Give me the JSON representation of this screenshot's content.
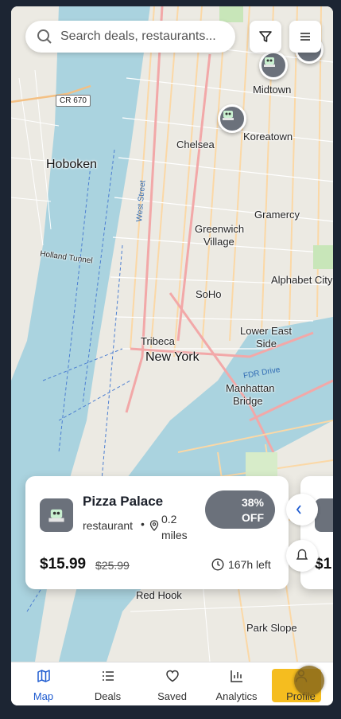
{
  "search": {
    "placeholder": "Search deals, restaurants..."
  },
  "map": {
    "labels": [
      {
        "name": "Hoboken",
        "kind": "big"
      },
      {
        "name": "Chelsea",
        "kind": "normal"
      },
      {
        "name": "Midtown",
        "kind": "normal"
      },
      {
        "name": "Koreatown",
        "kind": "normal"
      },
      {
        "name": "Gramercy",
        "kind": "normal"
      },
      {
        "name": "Greenwich",
        "kind": "normal"
      },
      {
        "name": "Village",
        "kind": "normal"
      },
      {
        "name": "Alphabet City",
        "kind": "normal"
      },
      {
        "name": "SoHo",
        "kind": "normal"
      },
      {
        "name": "Lower East",
        "kind": "normal"
      },
      {
        "name": "Side",
        "kind": "normal"
      },
      {
        "name": "Tribeca",
        "kind": "normal"
      },
      {
        "name": "New York",
        "kind": "big"
      },
      {
        "name": "Manhattan",
        "kind": "normal"
      },
      {
        "name": "Bridge",
        "kind": "normal"
      },
      {
        "name": "Red Hook",
        "kind": "normal"
      },
      {
        "name": "Park Slope",
        "kind": "normal"
      },
      {
        "name": "Holland Tunnel",
        "kind": "normal"
      },
      {
        "name": "CR 670",
        "kind": "shield"
      },
      {
        "name": "West Street",
        "kind": "road"
      },
      {
        "name": "FDR Drive",
        "kind": "road"
      }
    ]
  },
  "deal": {
    "name": "Pizza Palace",
    "type": "restaurant",
    "separator": "•",
    "distance": "0.2 miles",
    "discount_line1": "38%",
    "discount_line2": "OFF",
    "price": "$15.99",
    "old_price": "$25.99",
    "time_left": "167h left"
  },
  "next_deal": {
    "price_prefix": "$1"
  },
  "tabs": [
    {
      "label": "Map",
      "icon": "map-icon",
      "active": true
    },
    {
      "label": "Deals",
      "icon": "list-icon",
      "active": false
    },
    {
      "label": "Saved",
      "icon": "heart-icon",
      "active": false
    },
    {
      "label": "Analytics",
      "icon": "bar-chart-icon",
      "active": false
    },
    {
      "label": "Profile",
      "icon": "user-icon",
      "active": false
    }
  ],
  "colors": {
    "accent": "#1e5bd0",
    "pin": "#6b717b",
    "profile_highlight": "#f5bd1f"
  }
}
